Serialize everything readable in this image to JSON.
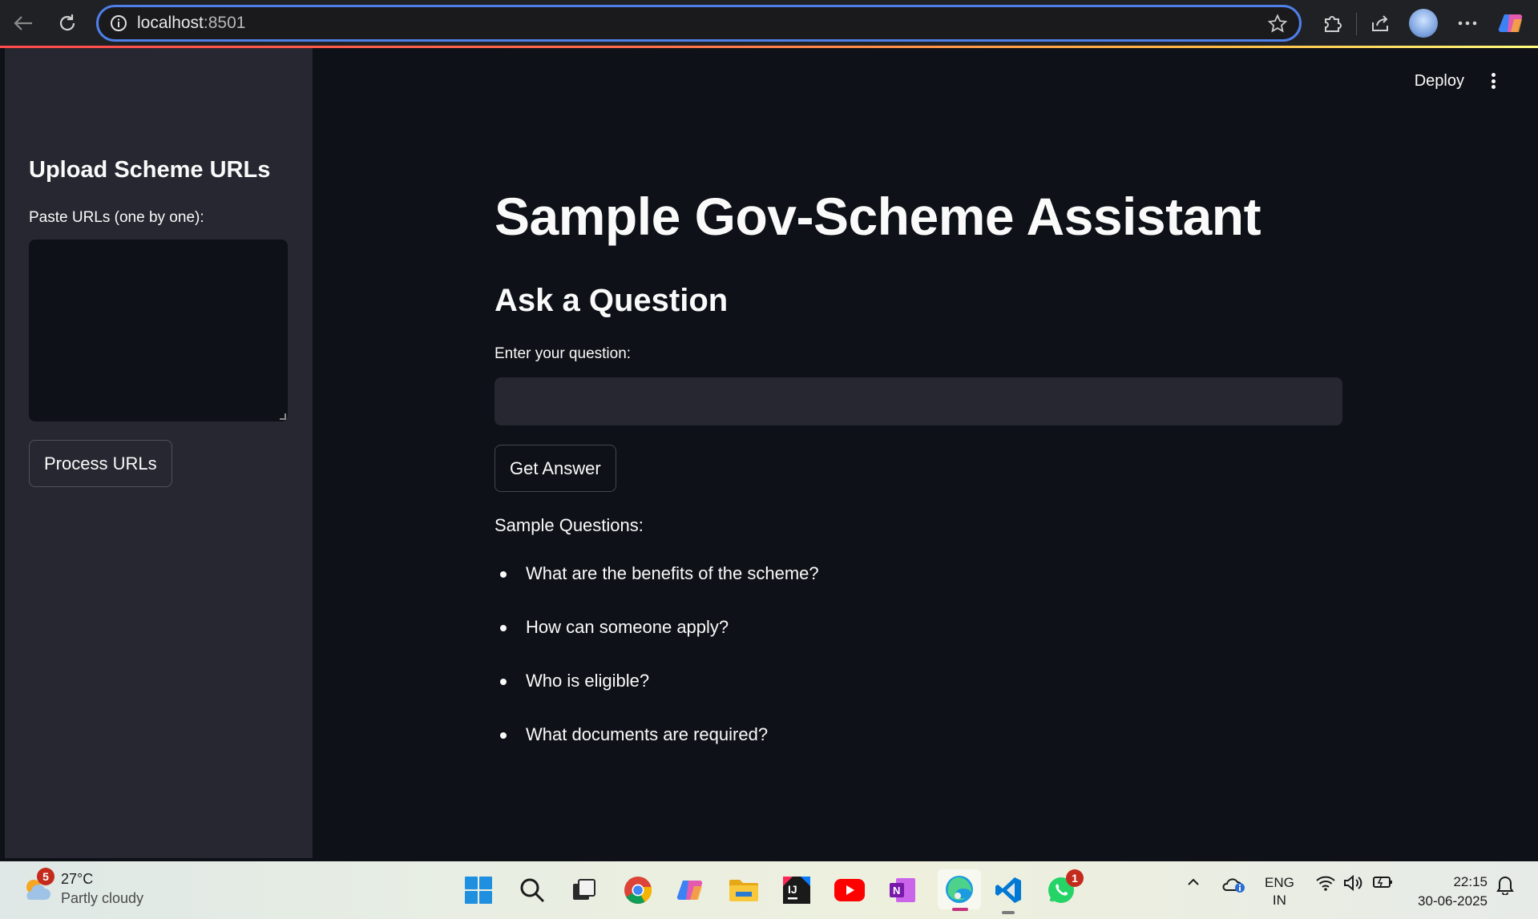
{
  "browser": {
    "url_host": "localhost",
    "url_port": ":8501"
  },
  "sidebar": {
    "title": "Upload Scheme URLs",
    "urls_label": "Paste URLs (one by one):",
    "urls_value": "",
    "process_button": "Process URLs"
  },
  "header": {
    "deploy_label": "Deploy"
  },
  "main": {
    "title": "Sample Gov-Scheme Assistant",
    "subtitle": "Ask a Question",
    "question_label": "Enter your question:",
    "question_value": "",
    "answer_button": "Get Answer",
    "sample_heading": "Sample Questions:",
    "sample_questions": [
      "What are the benefits of the scheme?",
      "How can someone apply?",
      "Who is eligible?",
      "What documents are required?"
    ]
  },
  "taskbar": {
    "weather_badge": "5",
    "temperature": "27°C",
    "weather_desc": "Partly cloudy",
    "whatsapp_badge": "1",
    "lang_top": "ENG",
    "lang_bottom": "IN",
    "time": "22:15",
    "date": "30-06-2025"
  },
  "colors": {
    "app_bg": "#0e1117",
    "sidebar_bg": "#262730",
    "input_bg": "#262730",
    "text": "#fafafa",
    "accent_line": "#ff4b4b"
  }
}
